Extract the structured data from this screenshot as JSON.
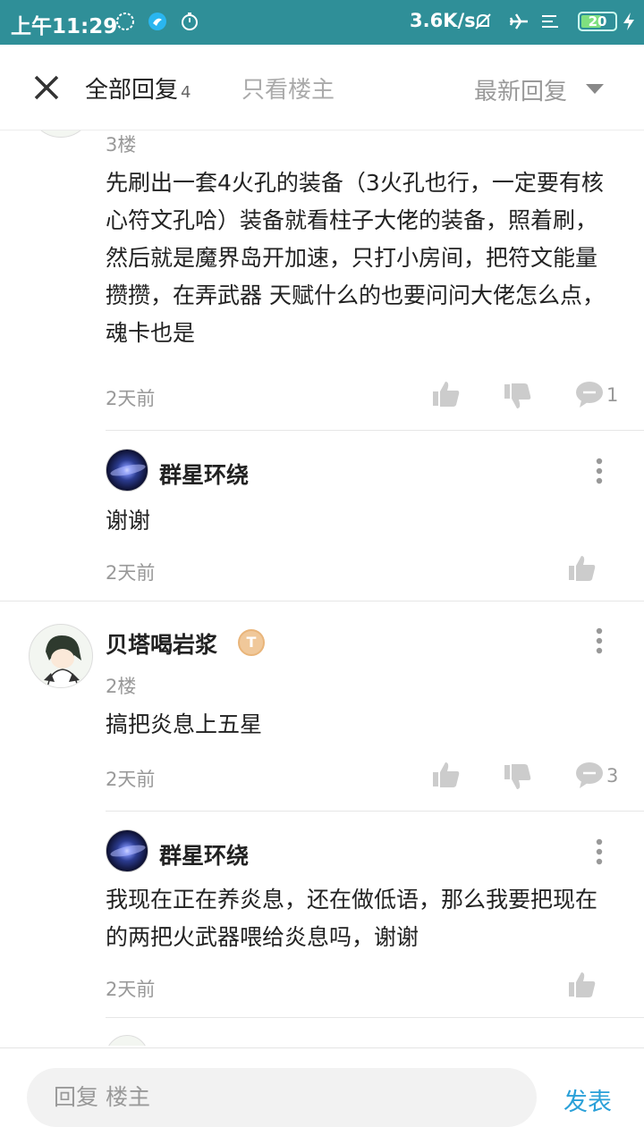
{
  "status_bar": {
    "time": "上午11:29",
    "net_speed": "3.6K/s",
    "battery": "20",
    "icons": [
      "circle-icon",
      "bird-icon",
      "timer-icon",
      "mute-bell-icon",
      "airplane-icon",
      "signal-icon",
      "battery-icon",
      "charging-icon"
    ]
  },
  "header": {
    "tab_all_label": "全部回复",
    "tab_all_count": "4",
    "tab_op_label": "只看楼主",
    "sort_label": "最新回复"
  },
  "comments": [
    {
      "floor": "3楼",
      "text": "先刷出一套4火孔的装备（3火孔也行，一定要有核心符文孔哈）装备就看柱子大佬的装备，照着刷，然后就是魔界岛开加速，只打小房间，把符文能量攒攒，在弄武器 天赋什么的也要问问大佬怎么点，魂卡也是",
      "time": "2天前",
      "reply_count": "1",
      "replies": [
        {
          "user": "群星环绕",
          "text": "谢谢",
          "time": "2天前"
        }
      ]
    },
    {
      "user": "贝塔喝岩浆",
      "badge": "T",
      "floor": "2楼",
      "text": "搞把炎息上五星",
      "time": "2天前",
      "reply_count": "3",
      "replies": [
        {
          "user": "群星环绕",
          "text": "我现在正在养炎息，还在做低语，那么我要把现在的两把火武器喂给炎息吗，谢谢",
          "time": "2天前"
        }
      ]
    }
  ],
  "footer": {
    "reply_placeholder": "回复  楼主",
    "post_label": "发表"
  },
  "colors": {
    "status_bar": "#2f8f98",
    "accent": "#2aa0d8",
    "muted_text": "#999999"
  }
}
